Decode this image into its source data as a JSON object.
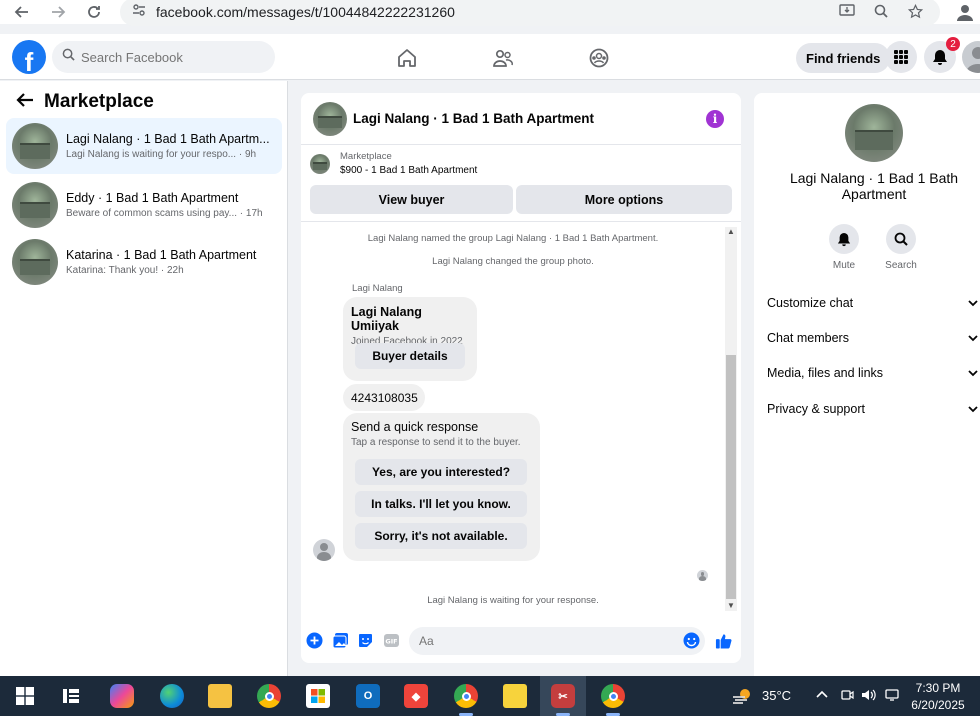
{
  "browser": {
    "url": "facebook.com/messages/t/10044842222231260"
  },
  "topbar": {
    "logo_letter": "f",
    "search_placeholder": "Search Facebook",
    "find_friends_label": "Find friends",
    "notifications_count": "2"
  },
  "sidebar": {
    "title": "Marketplace",
    "conversations": [
      {
        "title": "Lagi Nalang · 1 Bad 1 Bath Apartm...",
        "preview": "Lagi Nalang is waiting for your respo... · 9h",
        "active": true
      },
      {
        "title": "Eddy · 1 Bad 1 Bath Apartment",
        "preview": "Beware of common scams using pay... · 17h",
        "active": false
      },
      {
        "title": "Katarina · 1 Bad 1 Bath Apartment",
        "preview": "Katarina: Thank you! · 22h",
        "active": false
      }
    ]
  },
  "chat": {
    "title": "Lagi Nalang · 1 Bad 1 Bath Apartment",
    "info_icon_glyph": "i",
    "listing_label": "Marketplace",
    "listing_price": "$900 - 1 Bad 1 Bath Apartment",
    "view_buyer_label": "View buyer",
    "more_options_label": "More options",
    "system_messages": [
      "Lagi Nalang named the group Lagi Nalang · 1 Bad 1 Bath Apartment.",
      "Lagi Nalang changed the group photo."
    ],
    "sender_name": "Lagi Nalang",
    "buyer_card": {
      "name": "Lagi Nalang Umiiyak",
      "joined": "Joined Facebook in 2022",
      "button": "Buyer details"
    },
    "phone_message": "4243108035",
    "quick_response": {
      "title": "Send a quick response",
      "subtitle": "Tap a response to send it to the buyer.",
      "options": [
        "Yes, are you interested?",
        "In talks. I'll let you know.",
        "Sorry, it's not available."
      ]
    },
    "waiting_text": "Lagi Nalang is waiting for your response.",
    "composer_placeholder": "Aa"
  },
  "details": {
    "title": "Lagi Nalang · 1 Bad 1 Bath Apartment",
    "mute_label": "Mute",
    "search_label": "Search",
    "sections": [
      "Customize chat",
      "Chat members",
      "Media, files and links",
      "Privacy & support"
    ]
  },
  "taskbar": {
    "temperature": "35°C",
    "time": "7:30 PM",
    "date": "6/20/2025"
  },
  "colors": {
    "brand_blue": "#1877f2",
    "active_conv_bg": "#ebf5ff",
    "info_purple": "#a033d3",
    "badge_red": "#e41e3f",
    "taskbar_bg": "#1c2a3a"
  }
}
